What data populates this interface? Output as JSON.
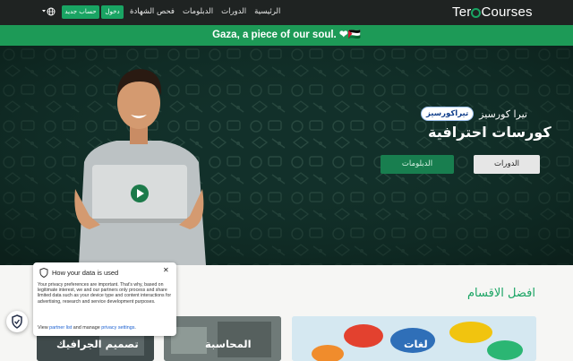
{
  "nav": {
    "logo_pre": "Ter",
    "logo_post": "Courses",
    "links": [
      "الرئيسية",
      "الدورات",
      "الدبلومات",
      "فحص الشهادة"
    ],
    "login_label": "دخول",
    "signup_label": "حساب جديد",
    "language_icon": "globe-icon"
  },
  "announcement": "Gaza, a piece of our soul. ❤🇵🇸",
  "hero": {
    "brand_ar": "تيرا كورسيز",
    "brand_badge": "تيراكورسيز",
    "subtitle": "كورسات احترافية",
    "courses_button": "الدورات",
    "diplomas_button": "الدبلومات"
  },
  "section": {
    "title": "افضل الاقسام",
    "cards": [
      "لغات",
      "المحاسبة",
      "تصميم الجرافيك"
    ]
  },
  "privacy": {
    "title": "How your data is used",
    "body": "Your privacy preferences are important. That's why, based on legitimate interest, we and our partners only process and share limited data such as your device type and content interactions for advertising, research and service development purposes.",
    "footer_prefix": "View",
    "partner_link": "partner list",
    "footer_mid": "and manage",
    "settings_link": "privacy settings",
    "footer_end": "."
  },
  "colors": {
    "brand_green": "#19a463",
    "nav_bg": "#1f2322",
    "hero_bg": "#0f2a24"
  }
}
